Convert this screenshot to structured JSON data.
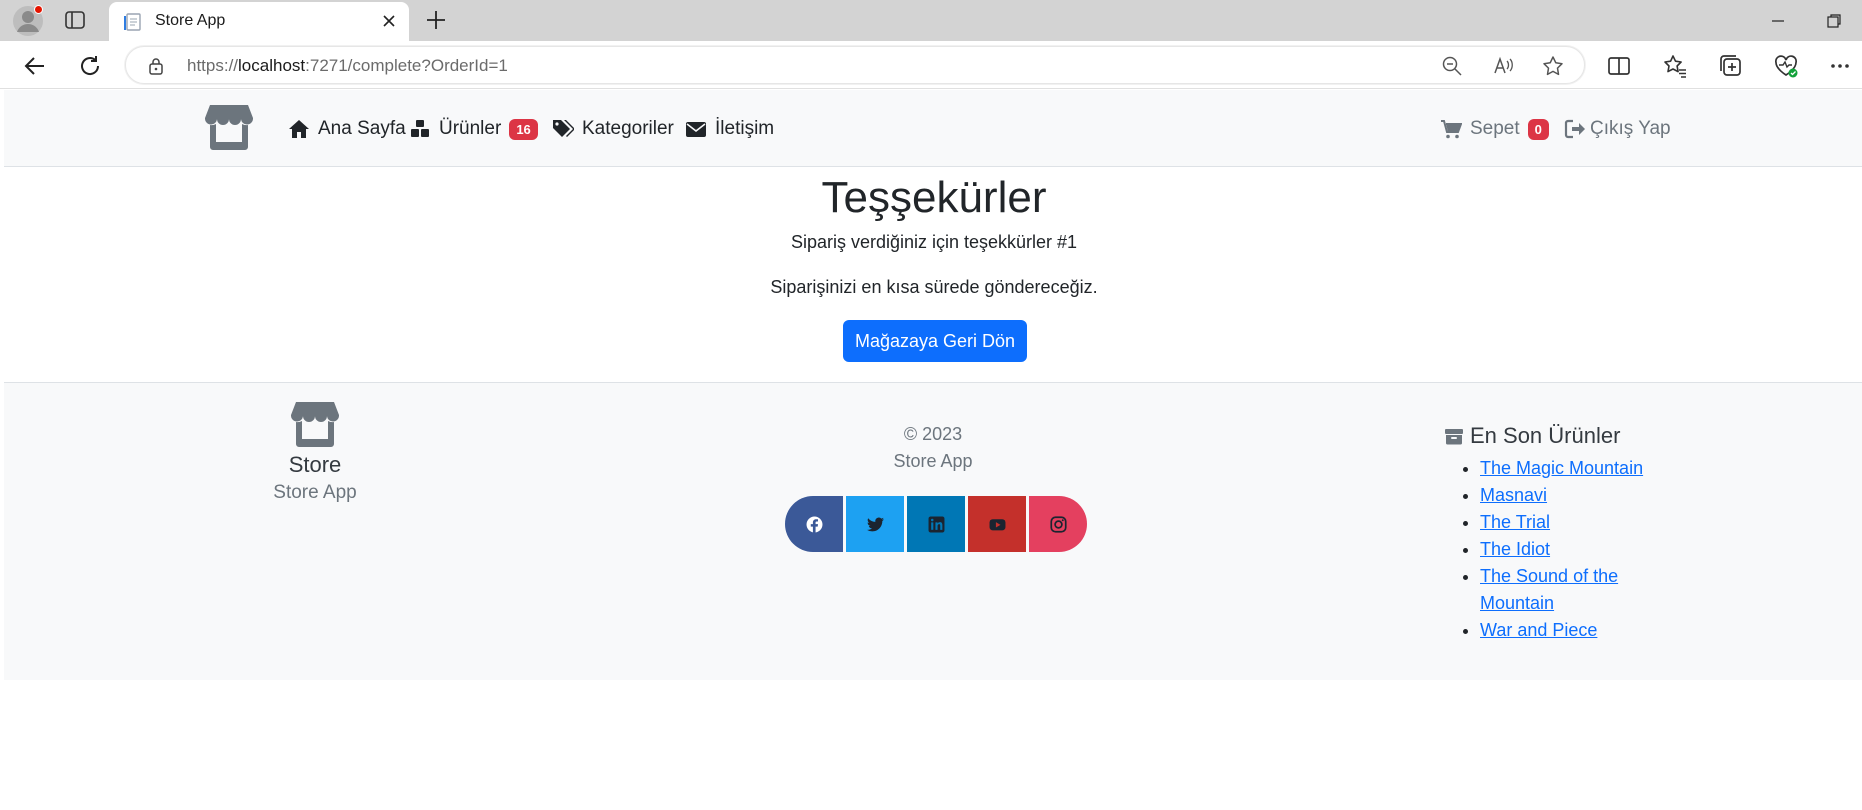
{
  "browser": {
    "tab_title": "Store App",
    "url_prefix": "https://",
    "url_host": "localhost",
    "url_rest": ":7271/complete?OrderId=1"
  },
  "navbar": {
    "home_label": "Ana Sayfa",
    "products_label": "Ürünler",
    "products_count": "16",
    "categories_label": "Kategoriler",
    "contact_label": "İletişim",
    "cart_label": "Sepet",
    "cart_count": "0",
    "logout_label": "Çıkış Yap"
  },
  "main": {
    "title": "Teşşekürler",
    "message_order": "Sipariş verdiğiniz için teşekkürler #1",
    "message_shipping": "Siparişinizi en kısa sürede göndereceğiz.",
    "back_button_label": "Mağazaya Geri Dön"
  },
  "footer": {
    "brand_name": "Store",
    "brand_subtitle": "Store App",
    "copyright": "© 2023",
    "app_name": "Store App",
    "social": [
      "facebook-icon",
      "twitter-icon",
      "linkedin-icon",
      "youtube-icon",
      "instagram-icon"
    ],
    "social_colors": [
      "#3b5998",
      "#1da1f2",
      "#0077b5",
      "#c4302b",
      "#e4405f"
    ],
    "latest_title": "En Son Ürünler",
    "latest_products": [
      "The Magic Mountain",
      "Masnavi",
      "The Trial",
      "The Idiot",
      "The Sound of the Mountain",
      "War and Piece"
    ]
  },
  "colors": {
    "primary": "#0d6efd",
    "badge": "#dc3545",
    "navbar_bg": "#f8f9fa"
  }
}
